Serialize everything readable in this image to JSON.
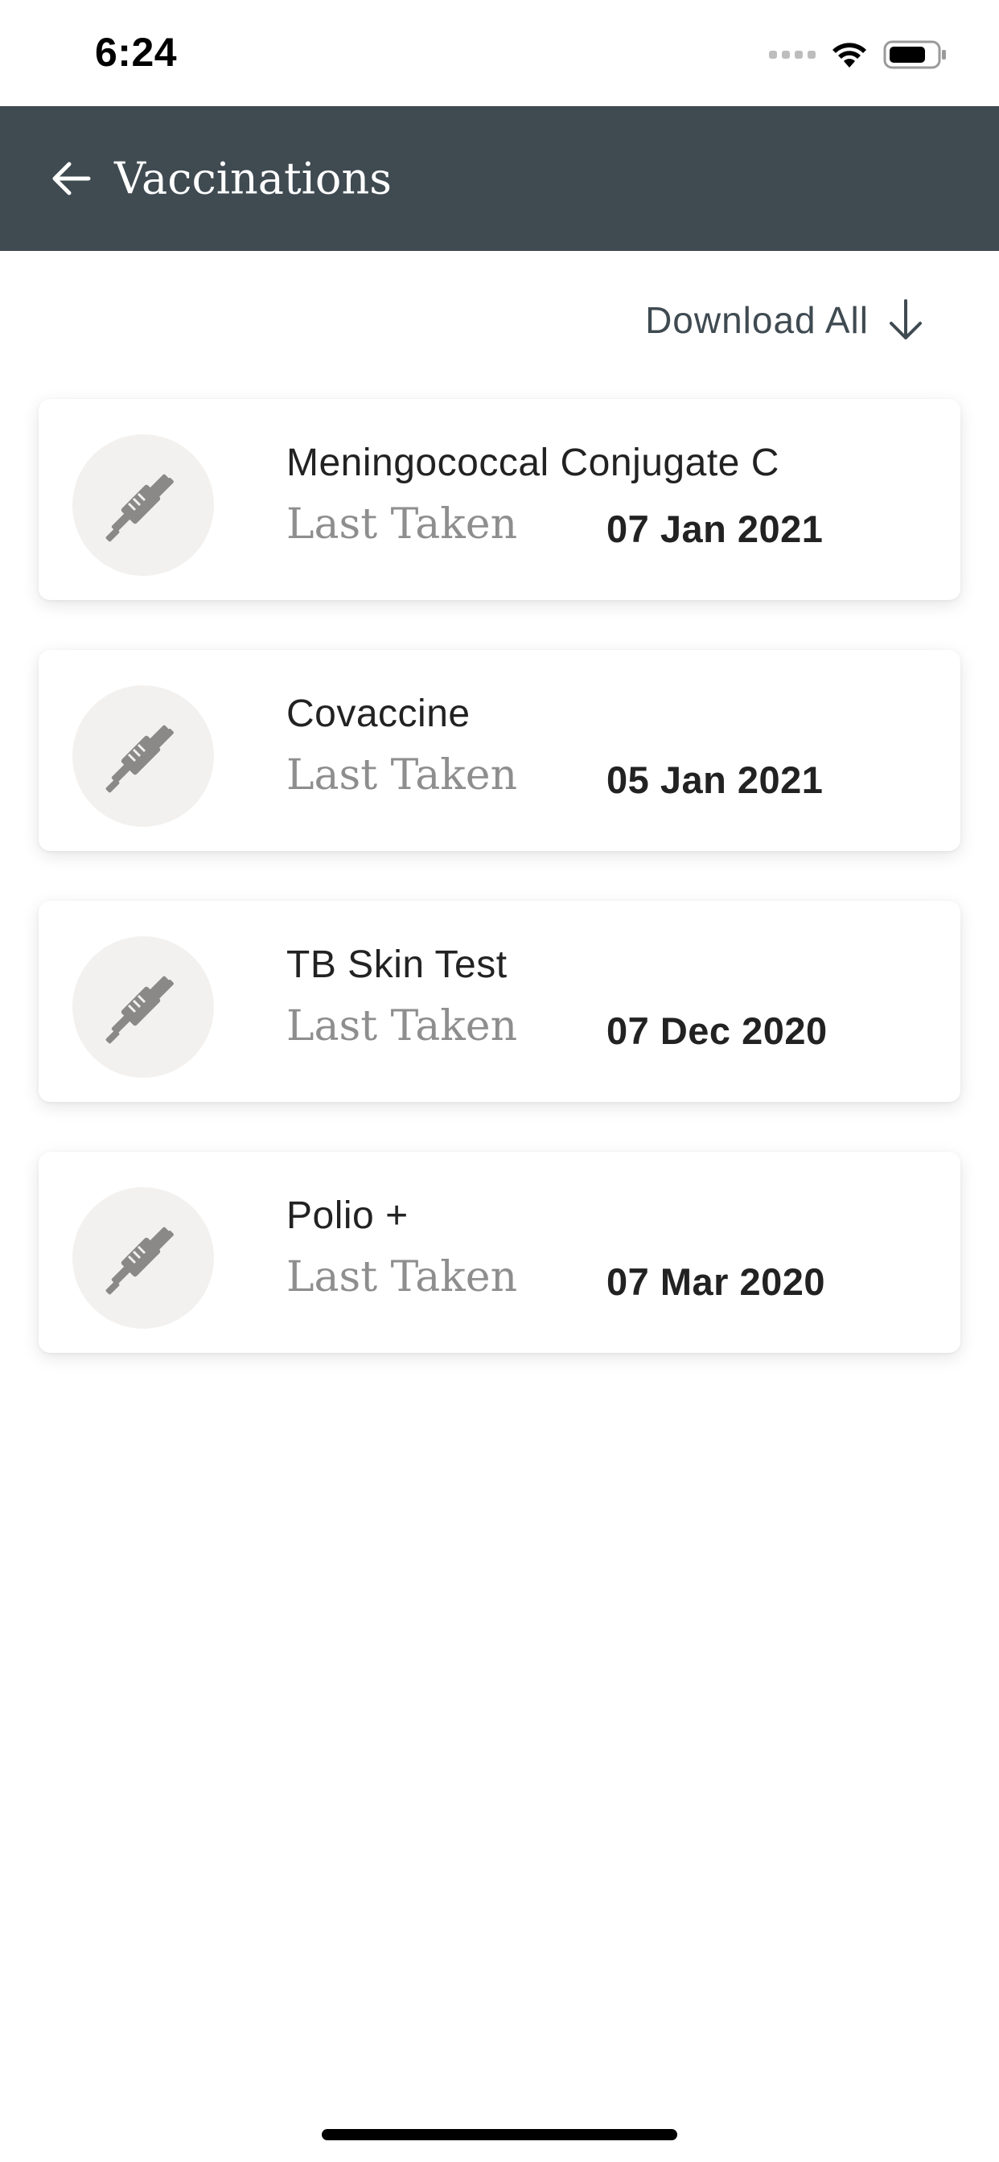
{
  "status_bar": {
    "time": "6:24",
    "icons": [
      "signal-dots-icon",
      "wifi-icon",
      "battery-icon"
    ]
  },
  "header": {
    "back_icon": "arrow-left-icon",
    "title": "Vaccinations",
    "background_color": "#3f4a51"
  },
  "download": {
    "label": "Download All",
    "icon": "arrow-down-icon"
  },
  "vaccinations": [
    {
      "name": "Meningococcal Conjugate C",
      "last_taken_label": "Last Taken",
      "date": "07 Jan 2021",
      "icon": "syringe-icon"
    },
    {
      "name": "Covaccine",
      "last_taken_label": "Last Taken",
      "date": "05 Jan 2021",
      "icon": "syringe-icon"
    },
    {
      "name": "TB Skin Test",
      "last_taken_label": "Last Taken",
      "date": "07 Dec 2020",
      "icon": "syringe-icon"
    },
    {
      "name": "Polio +",
      "last_taken_label": "Last Taken",
      "date": "07 Mar 2020",
      "icon": "syringe-icon"
    }
  ],
  "colors": {
    "icon_circle_bg": "#f3f1ef",
    "icon_color": "#8b8987",
    "text_primary": "#222222",
    "text_muted": "#8e8e8e"
  }
}
